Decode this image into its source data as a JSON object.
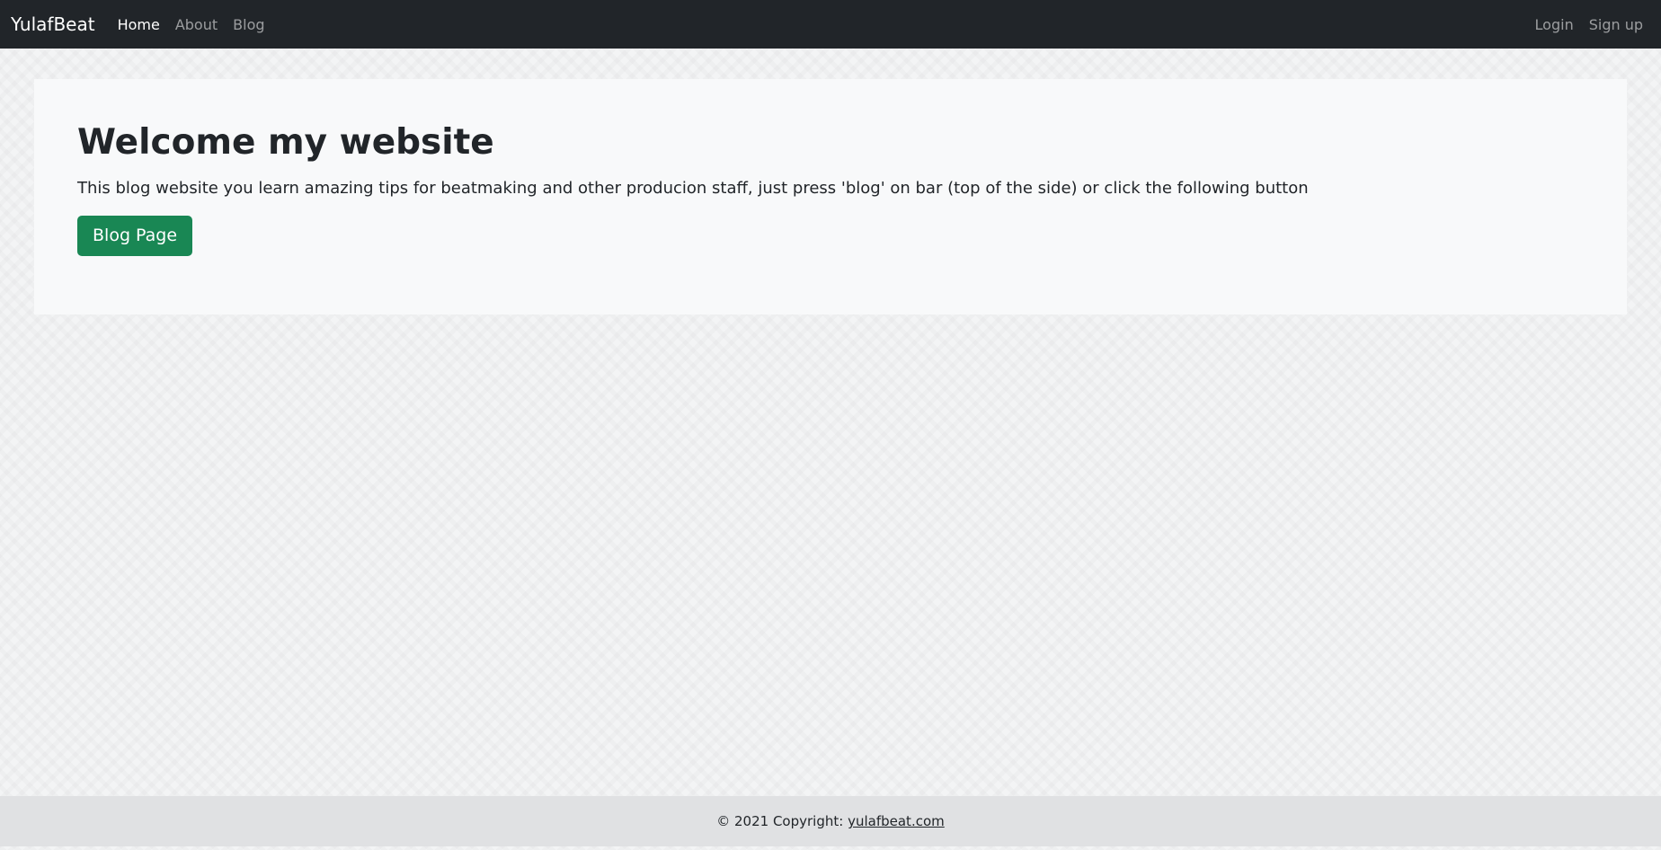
{
  "navbar": {
    "brand": "YulafBeat",
    "links": [
      {
        "label": "Home",
        "active": true
      },
      {
        "label": "About"
      },
      {
        "label": "Blog"
      }
    ],
    "auth": {
      "login_label": "Login",
      "signup_label": "Sign up"
    }
  },
  "hero": {
    "title": "Welcome my website",
    "lead": "This blog website you learn amazing tips for beatmaking and other producion staff, just press 'blog' on bar (top of the side) or click the following button",
    "button_label": "Blog Page"
  },
  "footer": {
    "copyright": "© 2021 Copyright: ",
    "link_text": "yulafbeat.com"
  },
  "colors": {
    "navbar_bg": "#212529",
    "button_bg": "#198754",
    "hero_bg": "#f8f9fa",
    "footer_bg": "#e0e1e3"
  }
}
